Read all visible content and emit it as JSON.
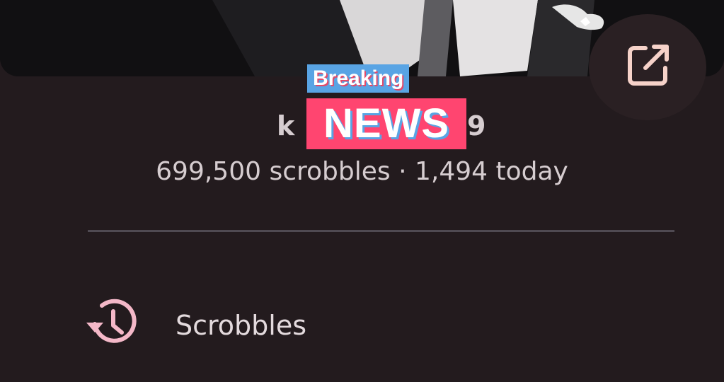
{
  "profile": {
    "username_visible_left": "k",
    "username_visible_right": "9",
    "stats": "699,500 scrobbles · 1,494 today"
  },
  "overlay": {
    "breaking": "Breaking",
    "news": "NEWS"
  },
  "menu": {
    "items": [
      {
        "label": "Scrobbles",
        "icon": "history-icon"
      }
    ]
  },
  "icons": {
    "open_external": "open-in-new-icon"
  },
  "colors": {
    "background": "#231b1e",
    "accent_pink": "#f4b8c8",
    "breaking_blue": "#59a4e4",
    "news_red": "#ff4570"
  }
}
